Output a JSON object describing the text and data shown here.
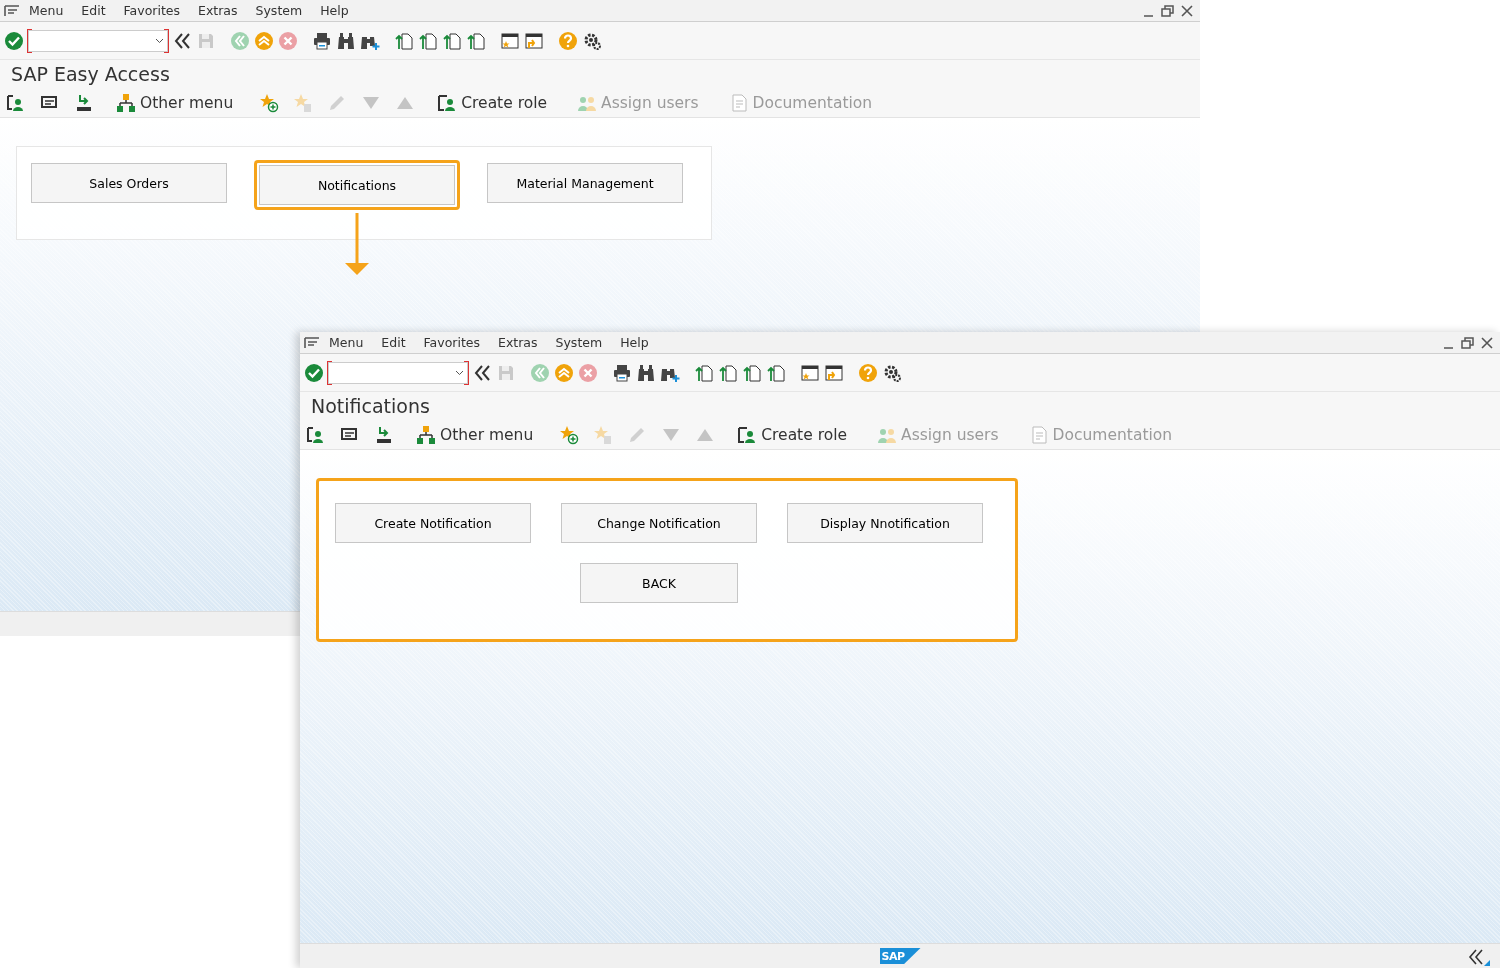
{
  "windows": [
    {
      "menu": [
        "Menu",
        "Edit",
        "Favorites",
        "Extras",
        "System",
        "Help"
      ],
      "title": "SAP Easy Access",
      "app_toolbar": [
        {
          "label": "Other menu",
          "disabled": false
        },
        {
          "label": "Create role",
          "disabled": false
        },
        {
          "label": "Assign users",
          "disabled": true
        },
        {
          "label": "Documentation",
          "disabled": true
        }
      ],
      "content": {
        "highlighted": false,
        "arrow": true,
        "button_rows": [
          [
            {
              "label": "Sales Orders",
              "highlighted": false
            },
            {
              "label": "Notifications",
              "highlighted": true
            },
            {
              "label": "Material Management",
              "highlighted": false
            }
          ]
        ]
      }
    },
    {
      "menu": [
        "Menu",
        "Edit",
        "Favorites",
        "Extras",
        "System",
        "Help"
      ],
      "title": "Notifications",
      "app_toolbar": [
        {
          "label": "Other menu",
          "disabled": false
        },
        {
          "label": "Create role",
          "disabled": false
        },
        {
          "label": "Assign users",
          "disabled": true
        },
        {
          "label": "Documentation",
          "disabled": true
        }
      ],
      "content": {
        "highlighted": true,
        "button_rows": [
          [
            {
              "label": "Create Notification",
              "highlighted": false
            },
            {
              "label": "Change Notification",
              "highlighted": false
            },
            {
              "label": "Display Nnotification",
              "highlighted": false
            }
          ],
          [
            {
              "label": "BACK",
              "highlighted": false
            }
          ]
        ]
      },
      "status_bar": {
        "logo": "SAP"
      }
    }
  ]
}
